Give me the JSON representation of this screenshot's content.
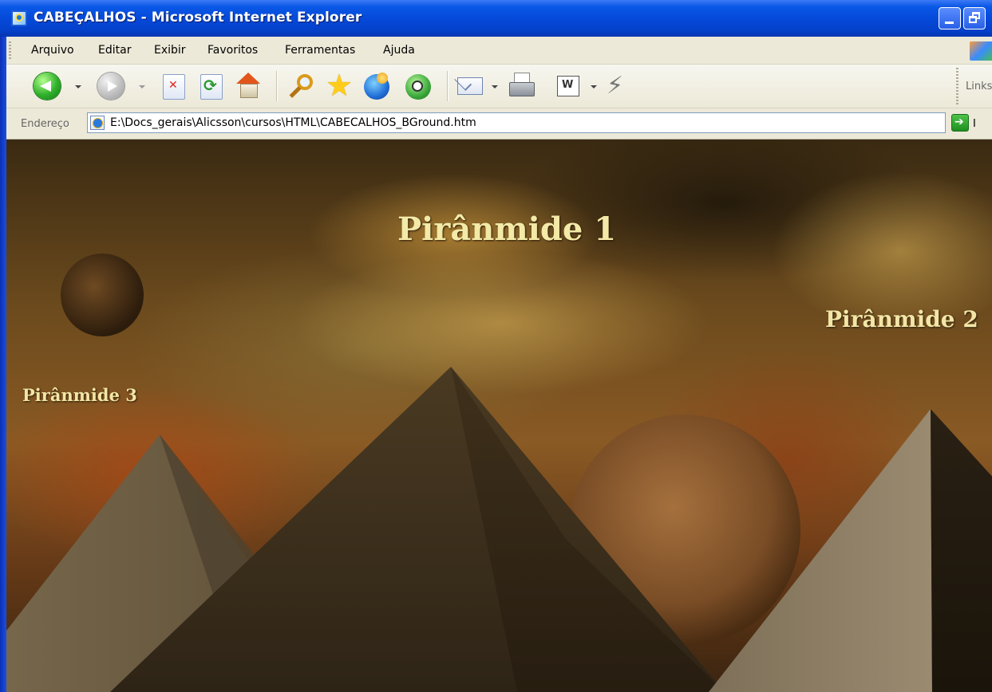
{
  "window": {
    "title": "CABEÇALHOS - Microsoft Internet Explorer"
  },
  "menu": {
    "items": [
      "Arquivo",
      "Editar",
      "Exibir",
      "Favoritos",
      "Ferramentas",
      "Ajuda"
    ]
  },
  "toolbar": {
    "buttons": [
      {
        "icon": "back-icon"
      },
      {
        "icon": "forward-icon"
      },
      {
        "icon": "stop-icon"
      },
      {
        "icon": "refresh-icon"
      },
      {
        "icon": "home-icon"
      },
      {
        "icon": "search-icon"
      },
      {
        "icon": "favorites-icon"
      },
      {
        "icon": "media-icon"
      },
      {
        "icon": "history-icon"
      },
      {
        "icon": "mail-icon"
      },
      {
        "icon": "print-icon"
      },
      {
        "icon": "edit-icon"
      },
      {
        "icon": "messenger-icon"
      }
    ],
    "links_label": "Links"
  },
  "address": {
    "label": "Endereço",
    "value": "E:\\Docs_gerais\\Alicsson\\cursos\\HTML\\CABECALHOS_BGround.htm",
    "go_label": "I"
  },
  "page": {
    "headings": {
      "h1": "Pirânmide 1",
      "h2": "Pirânmide 2",
      "h3": "Pirânmide 3"
    },
    "heading_color": "#f2e6a6"
  }
}
